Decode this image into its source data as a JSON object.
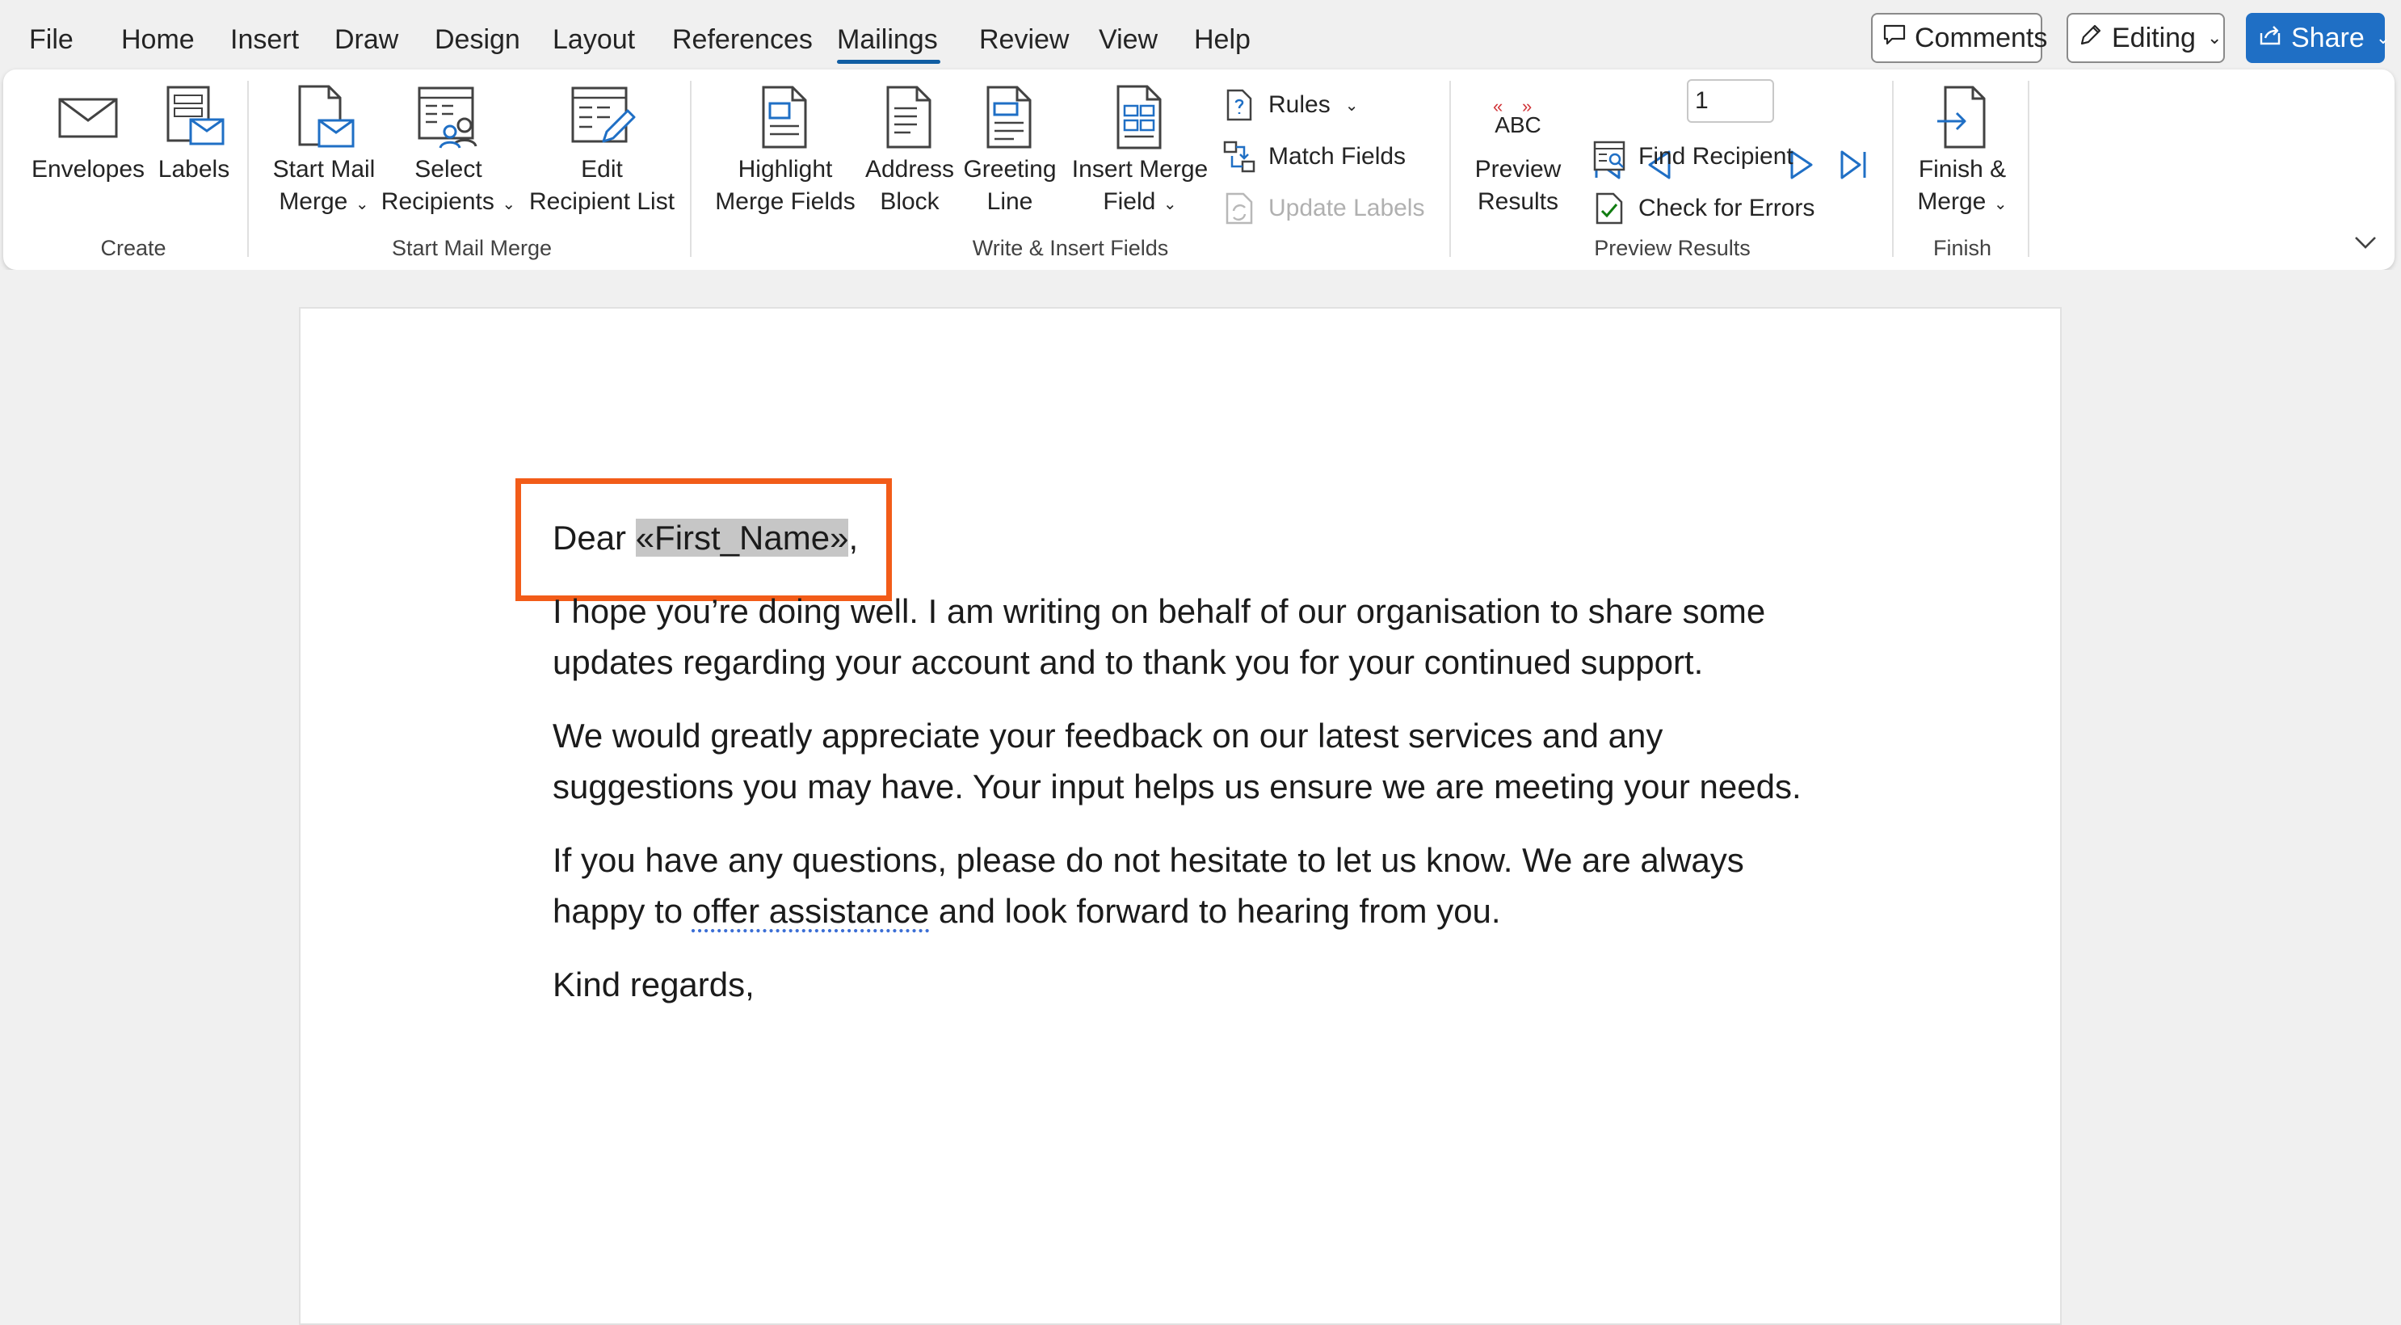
{
  "menu": {
    "tabs": [
      "File",
      "Home",
      "Insert",
      "Draw",
      "Design",
      "Layout",
      "References",
      "Mailings",
      "Review",
      "View",
      "Help"
    ],
    "active_tab": "Mailings",
    "comments_label": "Comments",
    "editing_label": "Editing",
    "share_label": "Share"
  },
  "ribbon": {
    "create": {
      "label": "Create",
      "envelopes": "Envelopes",
      "labels": "Labels"
    },
    "start_mail_merge": {
      "label": "Start Mail Merge",
      "start_line1": "Start Mail",
      "start_line2": "Merge",
      "select_line1": "Select",
      "select_line2": "Recipients",
      "edit_line1": "Edit",
      "edit_line2": "Recipient List"
    },
    "write_insert": {
      "label": "Write & Insert Fields",
      "highlight_line1": "Highlight",
      "highlight_line2": "Merge Fields",
      "address_line1": "Address",
      "address_line2": "Block",
      "greeting_line1": "Greeting",
      "greeting_line2": "Line",
      "insert_line1": "Insert Merge",
      "insert_line2": "Field",
      "rules": "Rules",
      "match_fields": "Match Fields",
      "update_labels": "Update Labels"
    },
    "preview": {
      "label": "Preview Results",
      "abc": "ABC",
      "preview_line1": "Preview",
      "preview_line2": "Results",
      "record_value": "1",
      "find_recipient": "Find Recipient",
      "check_errors": "Check for Errors"
    },
    "finish": {
      "label": "Finish",
      "finish_line1": "Finish &",
      "finish_line2": "Merge"
    }
  },
  "document": {
    "greeting_prefix": "Dear ",
    "merge_field": "«First_Name»",
    "greeting_suffix": ",",
    "p1_line1": "I hope you’re doing well. I am writing on behalf of our organisation to share some",
    "p1_line2": "updates regarding your account and to thank you for your continued support.",
    "p2_line1": "We would greatly appreciate your feedback on our latest services and any",
    "p2_line2": "suggestions you may have. Your input helps us ensure we are meeting your needs.",
    "p3_line1": "If you have any questions, please do not hesitate to let us know. We are always",
    "p3_line2_a": "happy to ",
    "p3_line2_b": "offer assistance",
    "p3_line2_c": " and look forward to hearing from you.",
    "closing": "Kind regards,"
  },
  "colors": {
    "accent": "#115ea3",
    "share_bg": "#1f6fc5",
    "highlight_box": "#f25c19",
    "merge_field_bg": "#c6c6c6"
  }
}
